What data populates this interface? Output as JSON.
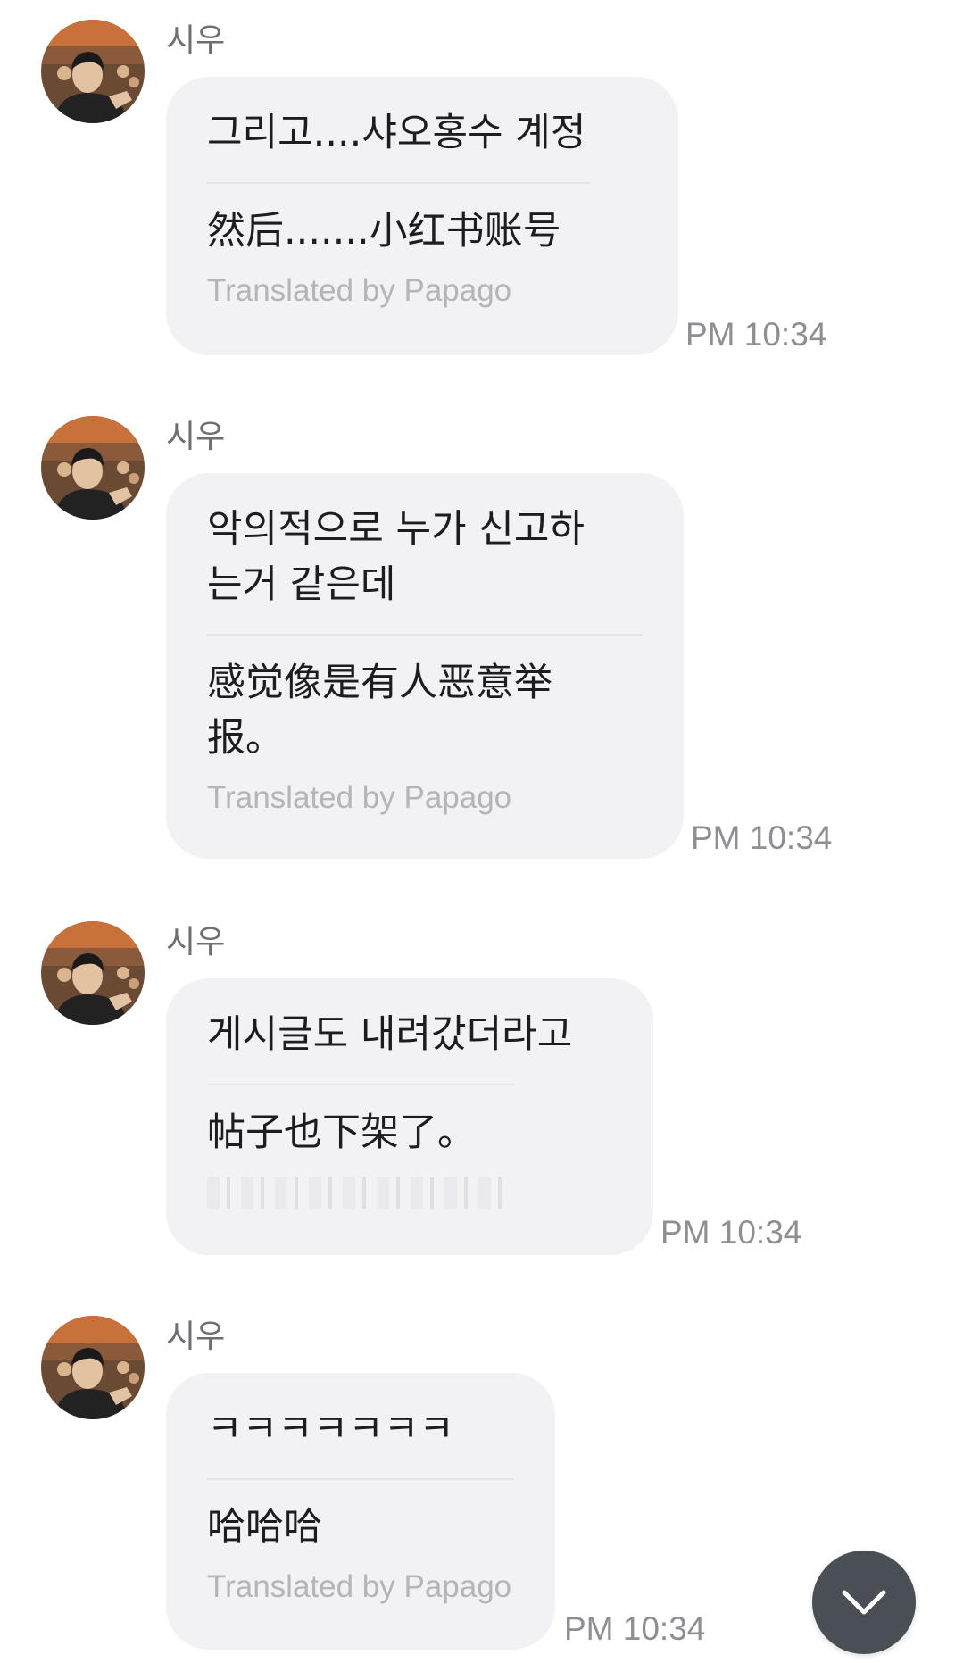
{
  "messages": [
    {
      "sender": "시우",
      "original": "그리고....샤오홍수 계정",
      "translation": "然后.......小红书账号",
      "credit": "Translated by Papago",
      "time": "PM 10:34"
    },
    {
      "sender": "시우",
      "original": "악의적으로 누가 신고하\n는거 같은데",
      "translation": "感觉像是有人恶意举\n报。",
      "credit": "Translated by Papago",
      "time": "PM 10:34"
    },
    {
      "sender": "시우",
      "original": "게시글도 내려갔더라고",
      "translation": "帖子也下架了。",
      "credit": "",
      "time": "PM 10:34"
    },
    {
      "sender": "시우",
      "original": "ㅋㅋㅋㅋㅋㅋㅋ",
      "translation": "哈哈哈",
      "credit": "Translated by Papago",
      "time": "PM 10:34"
    }
  ],
  "scroll_button": {
    "icon": "chevron-down-icon"
  },
  "colors": {
    "bubble": "#f2f2f5",
    "timestamp": "#8e8e93",
    "credit": "#b4b4b9",
    "scroll_button": "#4a4f56"
  }
}
